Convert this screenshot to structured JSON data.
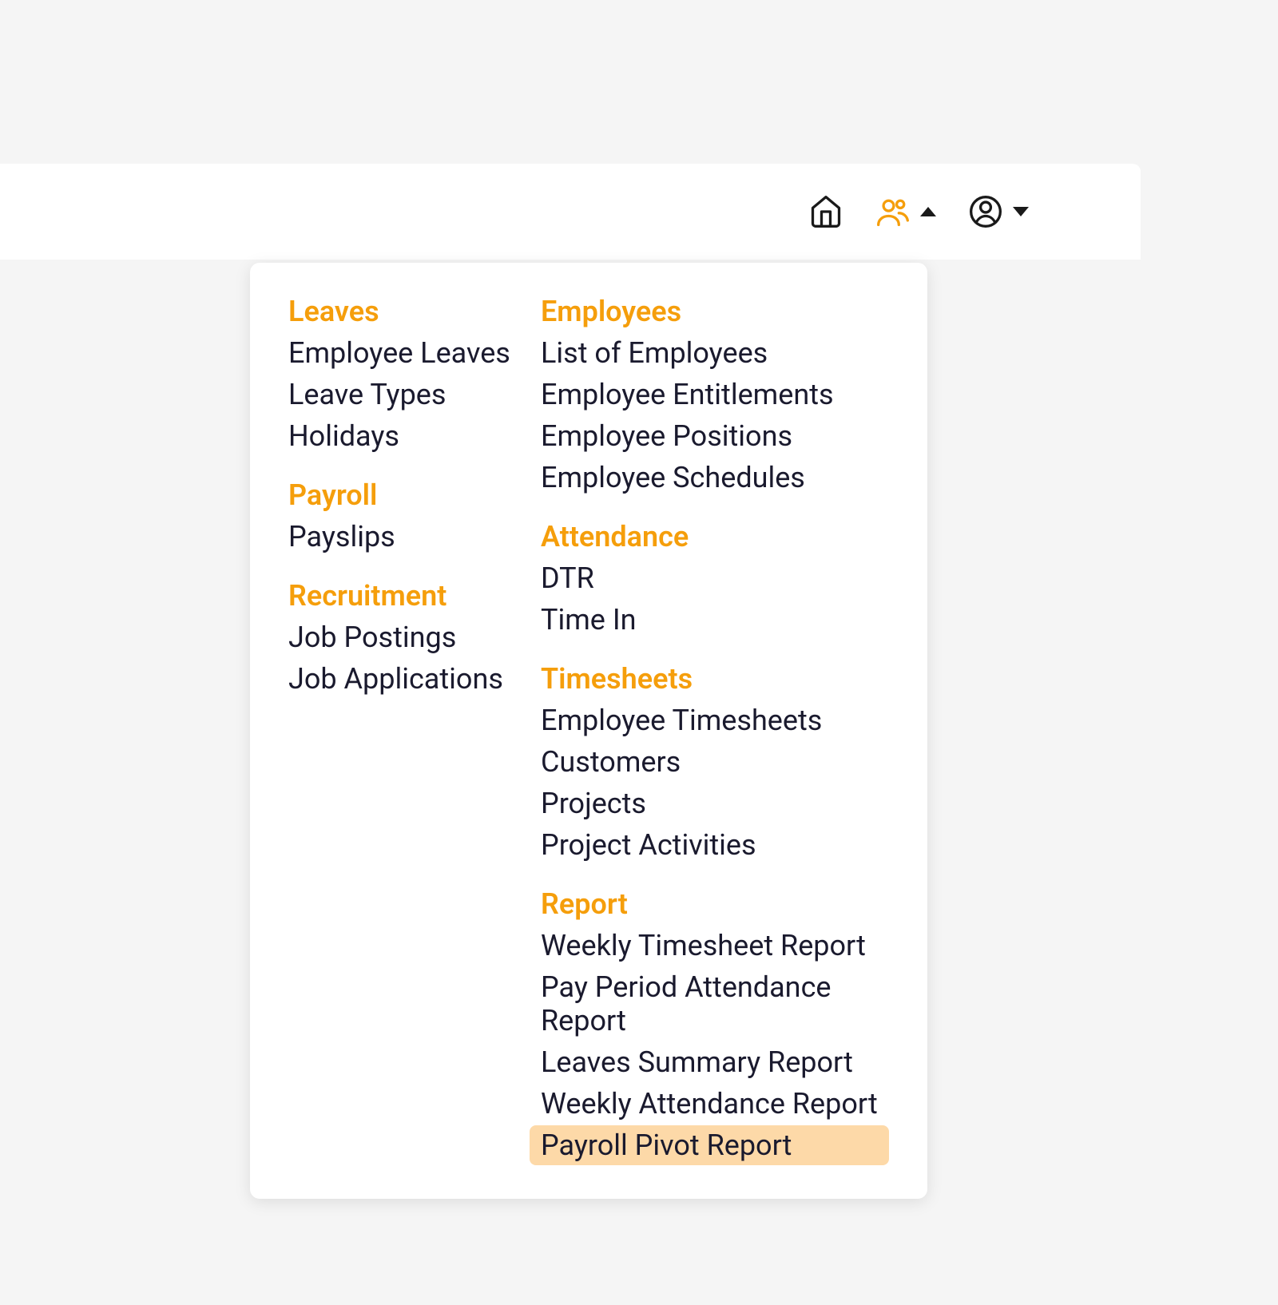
{
  "colors": {
    "accent": "#f59e0b",
    "highlight": "#fdd9a8",
    "text": "#1a1a2e",
    "background": "#f5f5f5"
  },
  "topbar": {
    "icons": [
      "home-icon",
      "people-icon",
      "profile-icon"
    ]
  },
  "menu": {
    "left": [
      {
        "header": "Leaves",
        "items": [
          "Employee Leaves",
          "Leave Types",
          "Holidays"
        ]
      },
      {
        "header": "Payroll",
        "items": [
          "Payslips"
        ]
      },
      {
        "header": "Recruitment",
        "items": [
          "Job Postings",
          "Job Applications"
        ]
      }
    ],
    "right": [
      {
        "header": "Employees",
        "items": [
          "List of Employees",
          "Employee Entitlements",
          "Employee Positions",
          "Employee Schedules"
        ]
      },
      {
        "header": "Attendance",
        "items": [
          "DTR",
          "Time In"
        ]
      },
      {
        "header": "Timesheets",
        "items": [
          "Employee Timesheets",
          "Customers",
          "Projects",
          "Project Activities"
        ]
      },
      {
        "header": "Report",
        "items": [
          "Weekly Timesheet Report",
          "Pay Period Attendance Report",
          "Leaves Summary Report",
          "Weekly Attendance Report",
          "Payroll Pivot Report"
        ]
      }
    ]
  },
  "highlighted_item": "Payroll Pivot Report"
}
